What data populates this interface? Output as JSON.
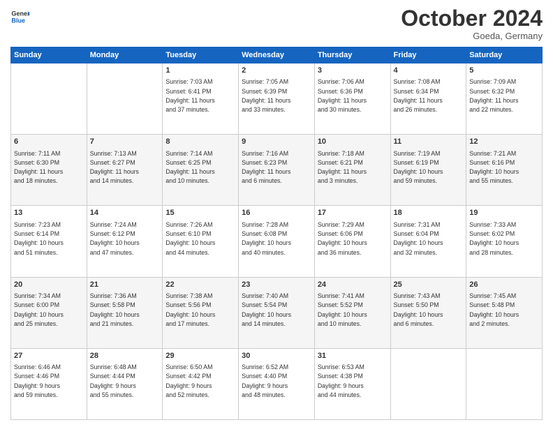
{
  "header": {
    "logo_line1": "General",
    "logo_line2": "Blue",
    "month": "October 2024",
    "location": "Goeda, Germany"
  },
  "days_of_week": [
    "Sunday",
    "Monday",
    "Tuesday",
    "Wednesday",
    "Thursday",
    "Friday",
    "Saturday"
  ],
  "weeks": [
    [
      {
        "day": "",
        "info": ""
      },
      {
        "day": "",
        "info": ""
      },
      {
        "day": "1",
        "info": "Sunrise: 7:03 AM\nSunset: 6:41 PM\nDaylight: 11 hours\nand 37 minutes."
      },
      {
        "day": "2",
        "info": "Sunrise: 7:05 AM\nSunset: 6:39 PM\nDaylight: 11 hours\nand 33 minutes."
      },
      {
        "day": "3",
        "info": "Sunrise: 7:06 AM\nSunset: 6:36 PM\nDaylight: 11 hours\nand 30 minutes."
      },
      {
        "day": "4",
        "info": "Sunrise: 7:08 AM\nSunset: 6:34 PM\nDaylight: 11 hours\nand 26 minutes."
      },
      {
        "day": "5",
        "info": "Sunrise: 7:09 AM\nSunset: 6:32 PM\nDaylight: 11 hours\nand 22 minutes."
      }
    ],
    [
      {
        "day": "6",
        "info": "Sunrise: 7:11 AM\nSunset: 6:30 PM\nDaylight: 11 hours\nand 18 minutes."
      },
      {
        "day": "7",
        "info": "Sunrise: 7:13 AM\nSunset: 6:27 PM\nDaylight: 11 hours\nand 14 minutes."
      },
      {
        "day": "8",
        "info": "Sunrise: 7:14 AM\nSunset: 6:25 PM\nDaylight: 11 hours\nand 10 minutes."
      },
      {
        "day": "9",
        "info": "Sunrise: 7:16 AM\nSunset: 6:23 PM\nDaylight: 11 hours\nand 6 minutes."
      },
      {
        "day": "10",
        "info": "Sunrise: 7:18 AM\nSunset: 6:21 PM\nDaylight: 11 hours\nand 3 minutes."
      },
      {
        "day": "11",
        "info": "Sunrise: 7:19 AM\nSunset: 6:19 PM\nDaylight: 10 hours\nand 59 minutes."
      },
      {
        "day": "12",
        "info": "Sunrise: 7:21 AM\nSunset: 6:16 PM\nDaylight: 10 hours\nand 55 minutes."
      }
    ],
    [
      {
        "day": "13",
        "info": "Sunrise: 7:23 AM\nSunset: 6:14 PM\nDaylight: 10 hours\nand 51 minutes."
      },
      {
        "day": "14",
        "info": "Sunrise: 7:24 AM\nSunset: 6:12 PM\nDaylight: 10 hours\nand 47 minutes."
      },
      {
        "day": "15",
        "info": "Sunrise: 7:26 AM\nSunset: 6:10 PM\nDaylight: 10 hours\nand 44 minutes."
      },
      {
        "day": "16",
        "info": "Sunrise: 7:28 AM\nSunset: 6:08 PM\nDaylight: 10 hours\nand 40 minutes."
      },
      {
        "day": "17",
        "info": "Sunrise: 7:29 AM\nSunset: 6:06 PM\nDaylight: 10 hours\nand 36 minutes."
      },
      {
        "day": "18",
        "info": "Sunrise: 7:31 AM\nSunset: 6:04 PM\nDaylight: 10 hours\nand 32 minutes."
      },
      {
        "day": "19",
        "info": "Sunrise: 7:33 AM\nSunset: 6:02 PM\nDaylight: 10 hours\nand 28 minutes."
      }
    ],
    [
      {
        "day": "20",
        "info": "Sunrise: 7:34 AM\nSunset: 6:00 PM\nDaylight: 10 hours\nand 25 minutes."
      },
      {
        "day": "21",
        "info": "Sunrise: 7:36 AM\nSunset: 5:58 PM\nDaylight: 10 hours\nand 21 minutes."
      },
      {
        "day": "22",
        "info": "Sunrise: 7:38 AM\nSunset: 5:56 PM\nDaylight: 10 hours\nand 17 minutes."
      },
      {
        "day": "23",
        "info": "Sunrise: 7:40 AM\nSunset: 5:54 PM\nDaylight: 10 hours\nand 14 minutes."
      },
      {
        "day": "24",
        "info": "Sunrise: 7:41 AM\nSunset: 5:52 PM\nDaylight: 10 hours\nand 10 minutes."
      },
      {
        "day": "25",
        "info": "Sunrise: 7:43 AM\nSunset: 5:50 PM\nDaylight: 10 hours\nand 6 minutes."
      },
      {
        "day": "26",
        "info": "Sunrise: 7:45 AM\nSunset: 5:48 PM\nDaylight: 10 hours\nand 2 minutes."
      }
    ],
    [
      {
        "day": "27",
        "info": "Sunrise: 6:46 AM\nSunset: 4:46 PM\nDaylight: 9 hours\nand 59 minutes."
      },
      {
        "day": "28",
        "info": "Sunrise: 6:48 AM\nSunset: 4:44 PM\nDaylight: 9 hours\nand 55 minutes."
      },
      {
        "day": "29",
        "info": "Sunrise: 6:50 AM\nSunset: 4:42 PM\nDaylight: 9 hours\nand 52 minutes."
      },
      {
        "day": "30",
        "info": "Sunrise: 6:52 AM\nSunset: 4:40 PM\nDaylight: 9 hours\nand 48 minutes."
      },
      {
        "day": "31",
        "info": "Sunrise: 6:53 AM\nSunset: 4:38 PM\nDaylight: 9 hours\nand 44 minutes."
      },
      {
        "day": "",
        "info": ""
      },
      {
        "day": "",
        "info": ""
      }
    ]
  ]
}
